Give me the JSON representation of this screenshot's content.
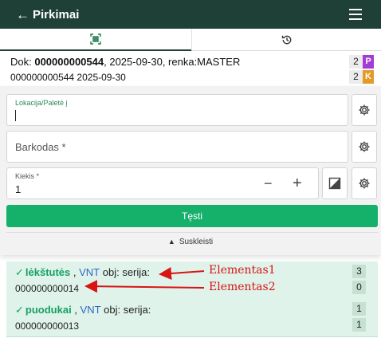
{
  "header": {
    "title": "Pirkimai",
    "back_icon": "arrow-left-icon",
    "menu_icon": "hamburger-menu-icon"
  },
  "tabs": [
    {
      "icon": "qr-scan-icon",
      "active": true
    },
    {
      "icon": "history-icon",
      "active": false
    }
  ],
  "document": {
    "prefix": "Dok: ",
    "number": "000000000544",
    "rest": ", 2025-09-30, renka:MASTER",
    "subline": "000000000544 2025-09-30",
    "counts": [
      {
        "value": "2",
        "tag": "P",
        "tag_color": "#a23cd3"
      },
      {
        "value": "2",
        "tag": "K",
        "tag_color": "#e39a26"
      }
    ]
  },
  "form": {
    "location_label": "Lokacija/Paletė į",
    "location_value": "",
    "barcode_placeholder": "Barkodas *",
    "quantity_label": "Kiekis *",
    "quantity_value": "1",
    "minus_label": "−",
    "plus_label": "+",
    "submit_label": "Tęsti",
    "collapse_label": "Suskleisti",
    "label_color": "#2c8a5a",
    "submit_color": "#15b06a"
  },
  "items": [
    {
      "name": "lėkštutės",
      "unit": "VNT",
      "obj_label": "obj: serija:",
      "code": "000000000014",
      "qty1": "3",
      "qty2": "0"
    },
    {
      "name": "puodukai",
      "unit": "VNT",
      "obj_label": "obj: serija:",
      "code": "000000000013",
      "qty1": "1",
      "qty2": "1"
    }
  ],
  "annotations": [
    {
      "text": "Elementas1"
    },
    {
      "text": "Elementas2"
    }
  ]
}
